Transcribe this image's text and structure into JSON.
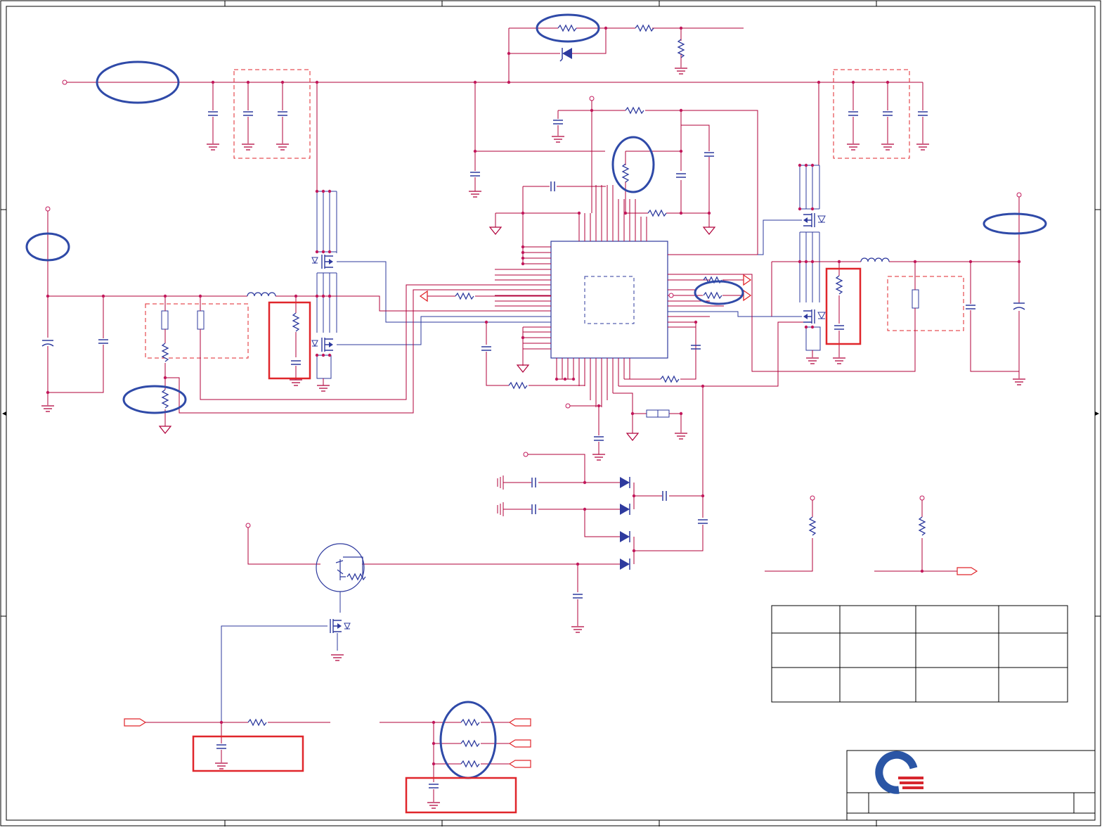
{
  "colors": {
    "background": "#ffffff",
    "border": "#000000",
    "power_net": "#b0003a",
    "signal_net": "#2b2b8c",
    "component": "#2e3a9e",
    "ground": "#b0003a",
    "highlight_circle": "#2f4aa8",
    "highlight_box": "#e0262b",
    "junction": "#c2185b",
    "logo_blue": "#2a55a5",
    "logo_red": "#d7262e"
  },
  "title_block": {
    "logo": "company-logo"
  }
}
